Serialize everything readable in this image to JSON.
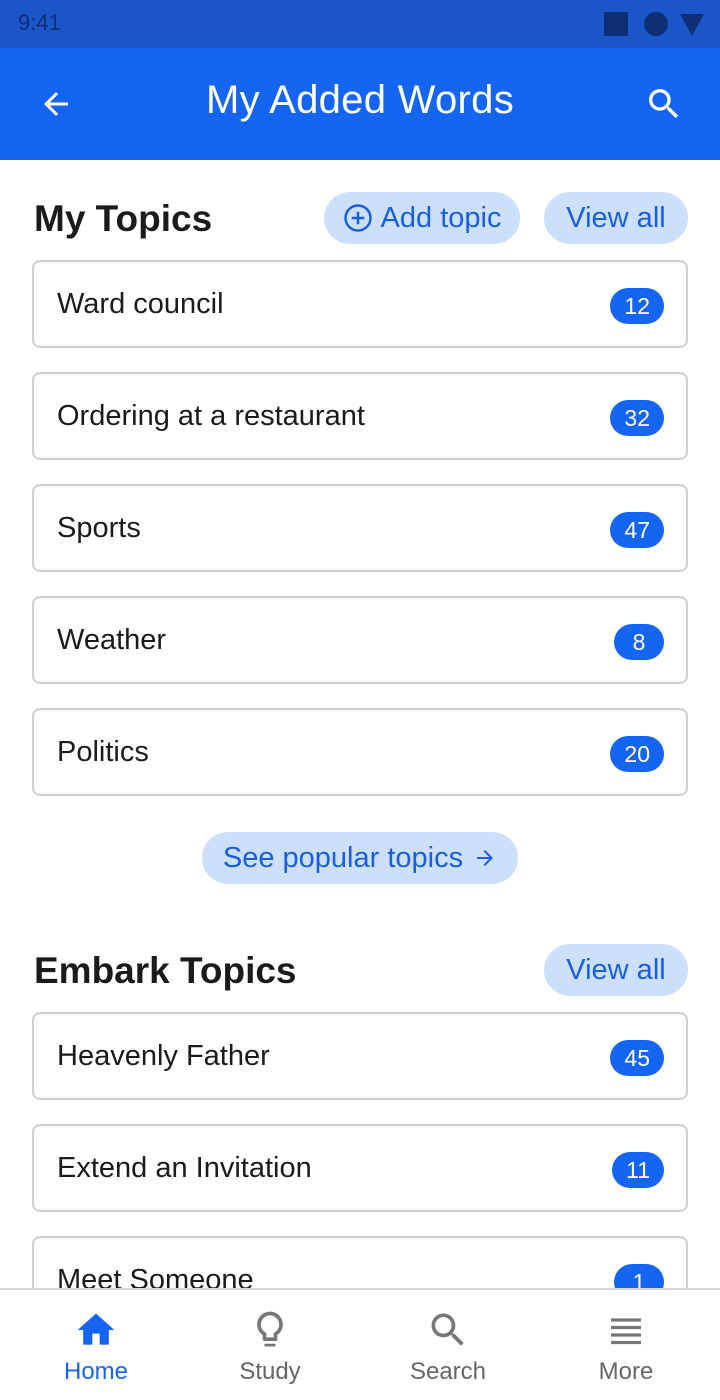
{
  "status_bar": {
    "time": "9:41"
  },
  "app_bar": {
    "title": "My Added Words"
  },
  "my_topics": {
    "title": "My Topics",
    "add_label": "Add topic",
    "view_all_label": "View all",
    "items": [
      {
        "label": "Ward council",
        "count": "12"
      },
      {
        "label": "Ordering at a restaurant",
        "count": "32"
      },
      {
        "label": "Sports",
        "count": "47"
      },
      {
        "label": "Weather",
        "count": "8"
      },
      {
        "label": "Politics",
        "count": "20"
      }
    ],
    "see_popular_label": "See popular topics"
  },
  "embark_topics": {
    "title": "Embark Topics",
    "view_all_label": "View all",
    "items": [
      {
        "label": "Heavenly Father",
        "count": "45"
      },
      {
        "label": "Extend an Invitation",
        "count": "11"
      },
      {
        "label": "Meet Someone",
        "count": "1"
      }
    ]
  },
  "bottom_nav": {
    "active": "Home",
    "items": [
      {
        "label": "Home",
        "icon": "home-icon"
      },
      {
        "label": "Study",
        "icon": "lightbulb-icon"
      },
      {
        "label": "Search",
        "icon": "search-icon"
      },
      {
        "label": "More",
        "icon": "menu-icon"
      }
    ]
  },
  "colors": {
    "primary": "#1565f2",
    "status_bar": "#1a56c8",
    "pill_bg": "#cde0fb",
    "pill_text": "#1a5fe0",
    "card_border": "#d0d0d0",
    "nav_inactive": "#666666"
  }
}
